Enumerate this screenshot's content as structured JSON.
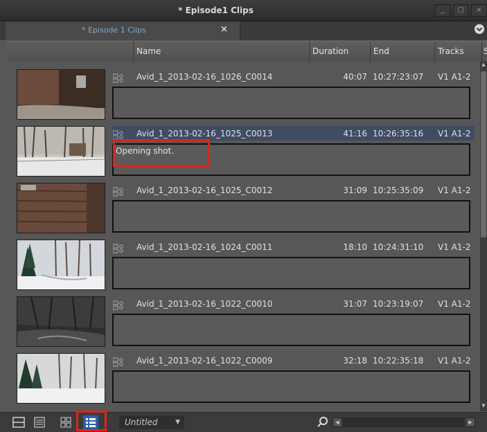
{
  "window": {
    "title": "* Episode1 Clips",
    "minimize_glyph": "_",
    "maximize_glyph": "□",
    "close_glyph": "×"
  },
  "tabs": [
    {
      "label": "* Episode 1 Clips",
      "close": "×",
      "active": true
    }
  ],
  "columns": {
    "name": "Name",
    "duration": "Duration",
    "end": "End",
    "tracks": "Tracks",
    "extra": "S"
  },
  "clips": [
    {
      "name": "Avid_1_2013-02-16_1026_C0014",
      "duration": "40:07",
      "end": "10:27:23:07",
      "tracks": "V1 A1-2",
      "comment": "",
      "selected": false
    },
    {
      "name": "Avid_1_2013-02-16_1025_C0013",
      "duration": "41:16",
      "end": "10:26:35:16",
      "tracks": "V1 A1-2",
      "comment": "Opening shot.",
      "selected": true
    },
    {
      "name": "Avid_1_2013-02-16_1025_C0012",
      "duration": "31:09",
      "end": "10:25:35:09",
      "tracks": "V1 A1-2",
      "comment": "",
      "selected": false
    },
    {
      "name": "Avid_1_2013-02-16_1024_C0011",
      "duration": "18:10",
      "end": "10:24:31:10",
      "tracks": "V1 A1-2",
      "comment": "",
      "selected": false
    },
    {
      "name": "Avid_1_2013-02-16_1022_C0010",
      "duration": "31:07",
      "end": "10:23:19:07",
      "tracks": "V1 A1-2",
      "comment": "",
      "selected": false
    },
    {
      "name": "Avid_1_2013-02-16_1022_C0009",
      "duration": "32:18",
      "end": "10:22:35:18",
      "tracks": "V1 A1-2",
      "comment": "",
      "selected": false
    }
  ],
  "bottom_bar": {
    "view_buttons": [
      "frame-view-icon",
      "text-view-icon",
      "script-view-icon",
      "storyboard-view-icon"
    ],
    "active_view": "storyboard-view-icon",
    "bin_name": "Untitled",
    "search_icon": "search-icon"
  },
  "colors": {
    "selection": "#3f4c63",
    "highlight": "#e0231d",
    "tab_text": "#7fa7d0",
    "active_view_button": "#2f5fa8"
  }
}
